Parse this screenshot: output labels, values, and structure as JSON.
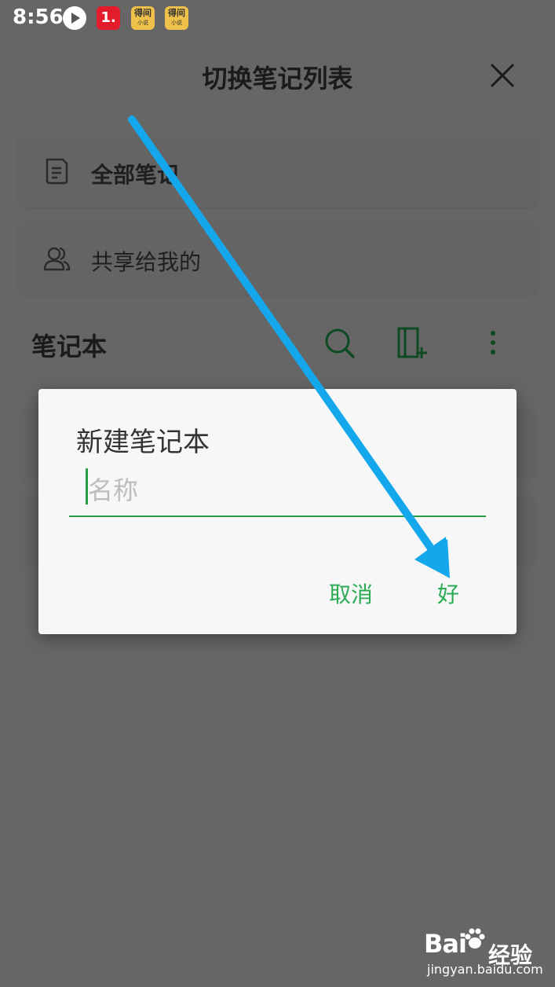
{
  "status_bar": {
    "time": "8:56",
    "icons": [
      "play-icon",
      "app-1-icon",
      "novel-app-icon",
      "novel-app-icon"
    ],
    "red_app_label": "1.",
    "novel_app_label": "得间",
    "novel_app_sub": "小说"
  },
  "header": {
    "title": "切换笔记列表",
    "close_icon": "close-icon"
  },
  "rows": {
    "all_notes": {
      "label": "全部笔记",
      "icon": "note-icon"
    },
    "shared_with_me": {
      "label": "共享给我的",
      "icon": "people-icon"
    }
  },
  "notebooks": {
    "title": "笔记本",
    "actions": [
      "search-icon",
      "new-notebook-icon",
      "more-icon"
    ]
  },
  "dialog": {
    "title": "新建笔记本",
    "input_placeholder": "名称",
    "input_value": "",
    "cancel_label": "取消",
    "ok_label": "好"
  },
  "watermark": {
    "brand": "Bai",
    "brand_tail": "经验",
    "url": "jingyan.baidu.com"
  },
  "colors": {
    "accent_green": "#2aac55",
    "annotation_blue": "#14a7ec",
    "overlay": "#666666",
    "dialog_bg": "#f7f7f7"
  }
}
